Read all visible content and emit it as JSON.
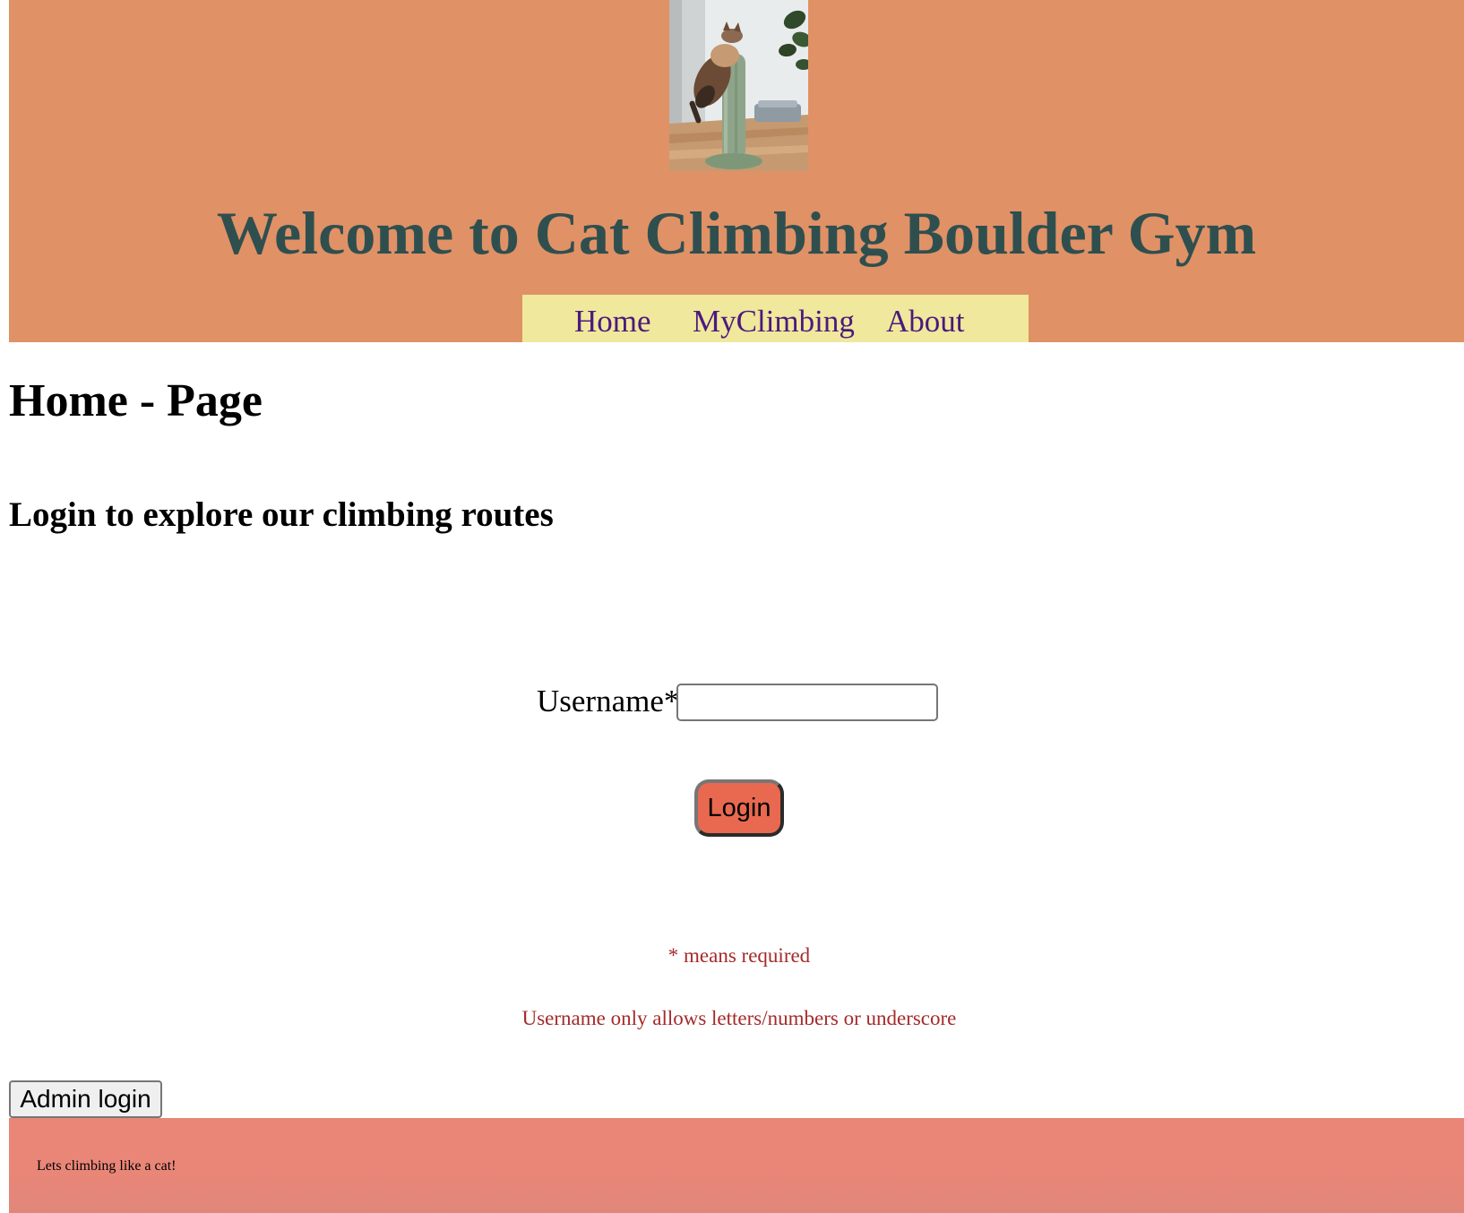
{
  "header": {
    "title": "Welcome to Cat Climbing Boulder Gym",
    "logo_icon": "cat-on-cactus-scratching-post-photo",
    "background_color": "#e09166",
    "title_color": "#2f4f4f"
  },
  "nav": {
    "background_color": "#f0e89c",
    "link_color": "#4b1a7d",
    "items": [
      {
        "label": "Home"
      },
      {
        "label": "MyClimbing"
      },
      {
        "label": "About"
      }
    ]
  },
  "main": {
    "page_heading": "Home - Page",
    "sub_heading": "Login to explore our climbing routes",
    "login_form": {
      "username_label": "Username*:",
      "username_value": "",
      "username_placeholder": "",
      "login_button_label": "Login",
      "login_button_color": "#e8694f"
    },
    "notes": {
      "required_note": "* means required",
      "username_rule": "Username only allows letters/numbers or underscore",
      "color": "#a52a2a"
    },
    "admin_button_label": "Admin login"
  },
  "footer": {
    "text": "Lets climbing like a cat!",
    "background_color": "#e98677"
  }
}
